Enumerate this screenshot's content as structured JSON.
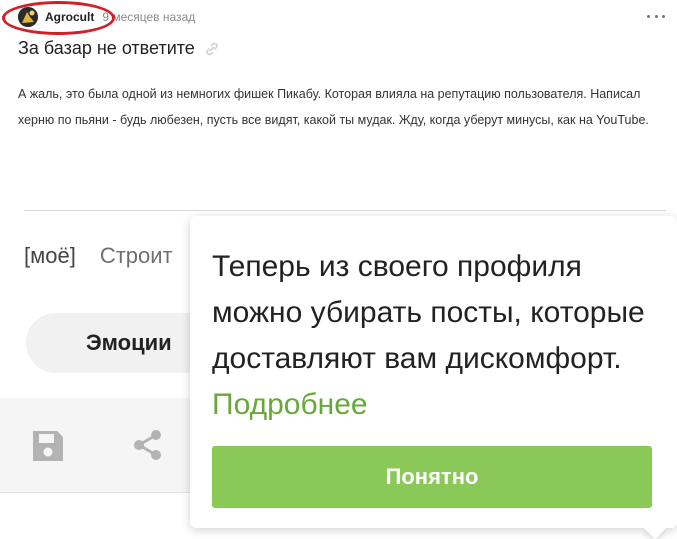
{
  "post": {
    "author": "Agrocult",
    "time": "9 месяцев назад",
    "title": "За базар не ответите",
    "body": "А жаль, это была одной из немногих фишек Пикабу. Которая влияла на репутацию пользователя. Написал херню по пьяни - будь любезен, пусть все видят, какой ты мудак. Жду, когда уберут минусы, как на YouTube."
  },
  "tags": [
    "[моё]",
    "Строит"
  ],
  "emotions": {
    "label": "Эмоции"
  },
  "popup": {
    "text": "Теперь из своего профиля можно убирать посты, которые доставляют вам дискомфорт.",
    "link_label": "Подробнее",
    "button_label": "Понятно"
  },
  "colors": {
    "accent_green": "#8ac858",
    "link_green": "#68a83b",
    "highlight_red": "#d41f26"
  },
  "icons": {
    "more": "more-dots-icon",
    "link": "link-icon",
    "save": "save-icon",
    "share": "share-icon"
  }
}
